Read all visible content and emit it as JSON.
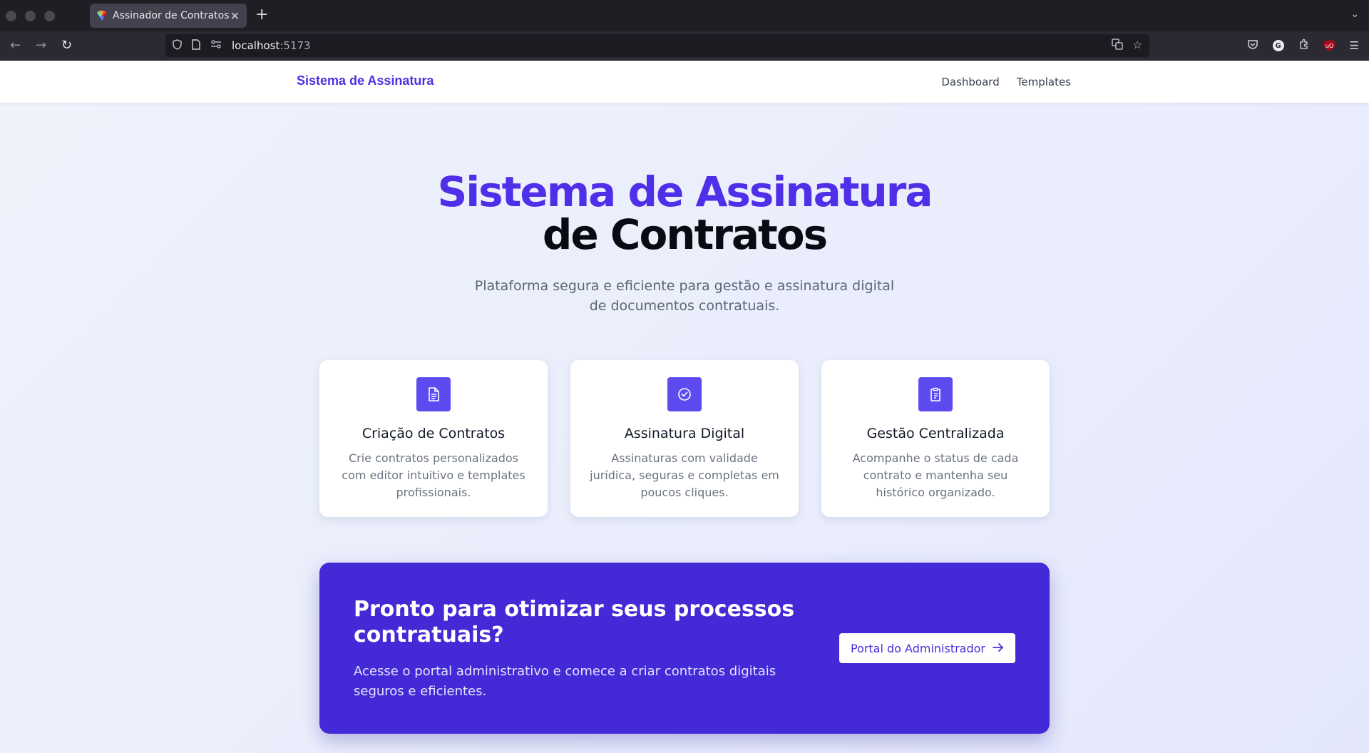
{
  "browser": {
    "tab_title": "Assinador de Contratos",
    "tab_close": "✕",
    "new_tab": "+",
    "url_host": "localhost",
    "url_port": ":5173"
  },
  "header": {
    "brand": "Sistema de Assinatura",
    "nav": [
      "Dashboard",
      "Templates"
    ]
  },
  "hero": {
    "title_line1": "Sistema de Assinatura",
    "title_line2": "de Contratos",
    "subtitle": "Plataforma segura e eficiente para gestão e assinatura digital de documentos contratuais."
  },
  "features": [
    {
      "icon": "document-icon",
      "title": "Criação de Contratos",
      "text": "Crie contratos personalizados com editor intuitivo e templates profissionais."
    },
    {
      "icon": "check-circle-icon",
      "title": "Assinatura Digital",
      "text": "Assinaturas com validade jurídica, seguras e completas em poucos cliques."
    },
    {
      "icon": "clipboard-icon",
      "title": "Gestão Centralizada",
      "text": "Acompanhe o status de cada contrato e mantenha seu histórico organizado."
    }
  ],
  "cta": {
    "title": "Pronto para otimizar seus processos contratuais?",
    "text": "Acesse o portal administrativo e comece a criar contratos digitais seguros e eficientes.",
    "button": "Portal do Administrador"
  },
  "colors": {
    "accent": "#4f2fe8",
    "cta_bg": "#432ad6",
    "icon_bg": "#5d4bf0"
  }
}
